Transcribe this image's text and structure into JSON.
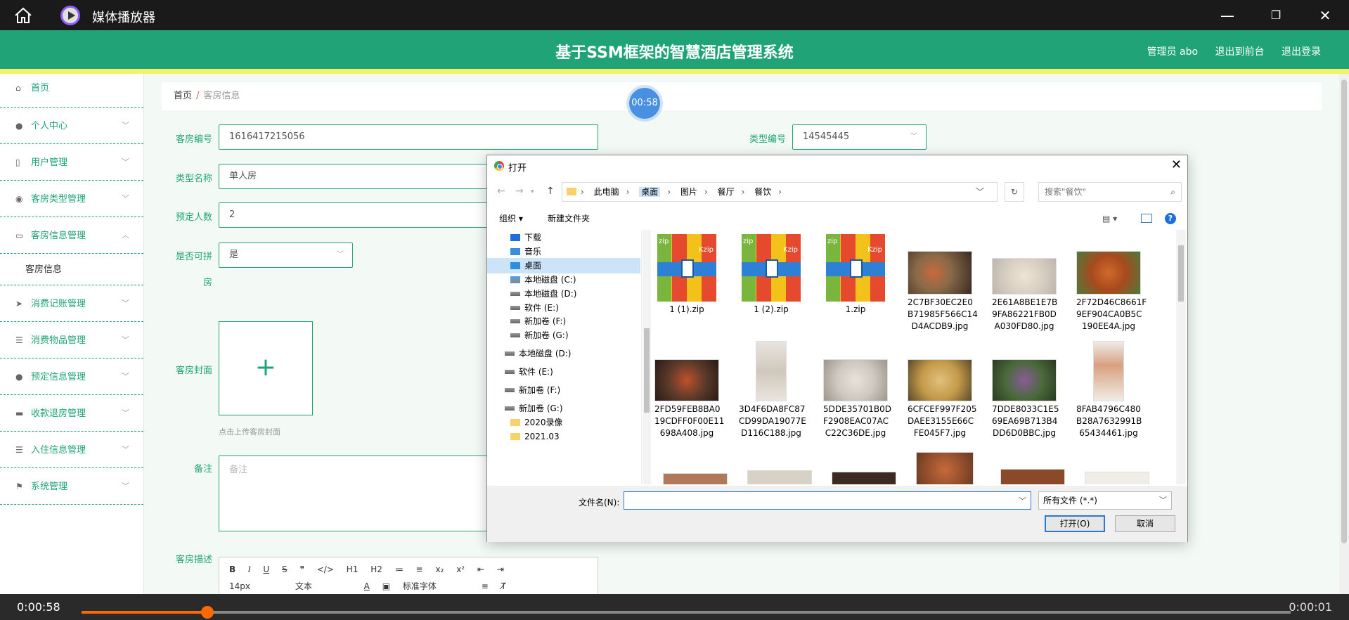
{
  "player": {
    "title": "媒体播放器",
    "time_current": "0:00:58",
    "time_total": "0:00:01",
    "progress": 0.104,
    "timer_badge": "00:58",
    "accent_color": "#ff6a00"
  },
  "header": {
    "system_title": "基于SSM框架的智慧酒店管理系统",
    "admin": "管理员 abo",
    "to_front": "退出到前台",
    "logout": "退出登录",
    "brand_color": "#1fa377"
  },
  "sidebar": {
    "items": [
      {
        "label": "首页",
        "icon": "home-icon"
      },
      {
        "label": "个人中心",
        "icon": "user-icon"
      },
      {
        "label": "用户管理",
        "icon": "phone-icon"
      },
      {
        "label": "客房类型管理",
        "icon": "pin-icon"
      },
      {
        "label": "客房信息管理",
        "icon": "chat-icon"
      },
      {
        "label": "客房信息",
        "icon": ""
      },
      {
        "label": "消费记账管理",
        "icon": "send-icon"
      },
      {
        "label": "消费物品管理",
        "icon": "list-icon"
      },
      {
        "label": "预定信息管理",
        "icon": "user-icon"
      },
      {
        "label": "收款退房管理",
        "icon": "cash-icon"
      },
      {
        "label": "入住信息管理",
        "icon": "list-icon"
      },
      {
        "label": "系统管理",
        "icon": "flag-icon"
      }
    ]
  },
  "breadcrumb": {
    "home": "首页",
    "sep": "/",
    "current": "客房信息"
  },
  "form": {
    "room_no_label": "客房编号",
    "room_no_value": "1616417215056",
    "type_no_label": "类型编号",
    "type_no_value": "14545445",
    "type_name_label": "类型名称",
    "type_name_value": "单人房",
    "capacity_label": "预定人数",
    "capacity_value": "2",
    "shareable_label_1": "是否可拼",
    "shareable_label_2": "房",
    "shareable_value": "是",
    "cover_label": "客房封面",
    "cover_hint": "点击上传客房封面",
    "remark_label": "备注",
    "remark_placeholder": "备注",
    "desc_label": "客房描述"
  },
  "editor": {
    "row1": [
      "B",
      "I",
      "U",
      "S",
      "❞",
      "</>",
      "H1",
      "H2",
      "≔",
      "≡",
      "x₂",
      "x²",
      "⇤",
      "⇥"
    ],
    "font_size": "14px",
    "text_style": "文本",
    "font_family": "标准字体"
  },
  "dialog": {
    "title": "打开",
    "address": {
      "path": [
        "此电脑",
        "桌面",
        "图片",
        "餐厅",
        "餐饮"
      ]
    },
    "search_placeholder": "搜索\"餐饮\"",
    "organize": "组织 ▾",
    "new_folder": "新建文件夹",
    "tree": [
      {
        "label": "下载",
        "kind": "download"
      },
      {
        "label": "音乐",
        "kind": "music"
      },
      {
        "label": "桌面",
        "kind": "desktop",
        "selected": true
      },
      {
        "label": "本地磁盘 (C:)",
        "kind": "drive"
      },
      {
        "label": "本地磁盘 (D:)",
        "kind": "drive"
      },
      {
        "label": "软件 (E:)",
        "kind": "drive"
      },
      {
        "label": "新加卷 (F:)",
        "kind": "drive"
      },
      {
        "label": "新加卷 (G:)",
        "kind": "drive"
      },
      {
        "label": "本地磁盘 (D:)",
        "kind": "drive"
      },
      {
        "label": "软件 (E:)",
        "kind": "drive"
      },
      {
        "label": "新加卷 (F:)",
        "kind": "drive"
      },
      {
        "label": "新加卷 (G:)",
        "kind": "drive"
      },
      {
        "label": "2020录像",
        "kind": "folder"
      },
      {
        "label": "2021.03",
        "kind": "folder"
      }
    ],
    "files": [
      {
        "name": [
          "1 (1).zip"
        ],
        "kind": "zip"
      },
      {
        "name": [
          "1 (2).zip"
        ],
        "kind": "zip"
      },
      {
        "name": [
          "1.zip"
        ],
        "kind": "zip"
      },
      {
        "name": [
          "2C7BF30EC2E0",
          "B71985F566C14",
          "D4ACDB9.jpg"
        ],
        "kind": "photo",
        "color": "#8a6a4a"
      },
      {
        "name": [
          "2E61A8BE1E7B",
          "9FA86221FB0D",
          "A030FD80.jpg"
        ],
        "kind": "photo",
        "color": "#d8cfc2"
      },
      {
        "name": [
          "2F72D46C8661F",
          "9EF904CA0B5C",
          "190EE4A.jpg"
        ],
        "kind": "photo",
        "color": "#a84a1e"
      },
      {
        "name": [
          "2FD59FEB8BA0",
          "19CDFF0F00E11",
          "698A408.jpg"
        ],
        "kind": "photo",
        "color": "#5a3a2a"
      },
      {
        "name": [
          "3D4F6DA8FC87",
          "CD99DA19077E",
          "D116C188.jpg"
        ],
        "kind": "photo-tall",
        "color": "#e8e4de"
      },
      {
        "name": [
          "5DDE35701B0D",
          "F2908EAC07AC",
          "C22C36DE.jpg"
        ],
        "kind": "photo",
        "color": "#cfc8c0"
      },
      {
        "name": [
          "6CFCEF997F205",
          "DAEE3155E66C",
          "FE045F7.jpg"
        ],
        "kind": "photo",
        "color": "#c49a4a"
      },
      {
        "name": [
          "7DDE8033C1E5",
          "69EA69B713B4",
          "DD6D0BBC.jpg"
        ],
        "kind": "photo",
        "color": "#4a6a3a"
      },
      {
        "name": [
          "8FAB4796C480",
          "B28A7632991B",
          "65434461.jpg"
        ],
        "kind": "photo-tall",
        "color": "#f0ece6"
      }
    ],
    "filename_label": "文件名(N):",
    "filetype": "所有文件 (*.*)",
    "open_btn": "打开(O)",
    "cancel_btn": "取消"
  }
}
